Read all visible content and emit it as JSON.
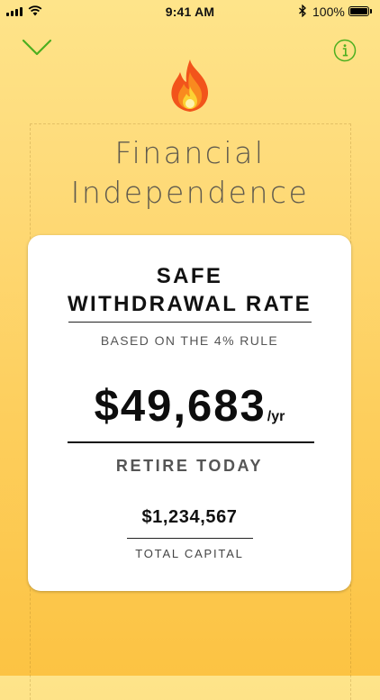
{
  "status_bar": {
    "time": "9:41 AM",
    "battery_percent": "100%"
  },
  "nav": {
    "left_icon": "checkmark-icon",
    "right_icon": "info-icon",
    "accent_color": "#4CAF1F"
  },
  "hero_icon": "fire-emoji-icon",
  "title": {
    "line1": "Financial",
    "line2": "Independence"
  },
  "card": {
    "heading_line1": "SAFE",
    "heading_line2": "WITHDRAWAL RATE",
    "subtitle": "BASED ON THE 4% RULE",
    "amount": "$49,683",
    "amount_unit": "/yr",
    "action_label": "RETIRE TODAY",
    "capital_value": "$1,234,567",
    "capital_label": "TOTAL CAPITAL"
  },
  "colors": {
    "background_top": "#FEE48A",
    "background_bottom": "#FCC343",
    "card": "#FFFFFF"
  }
}
